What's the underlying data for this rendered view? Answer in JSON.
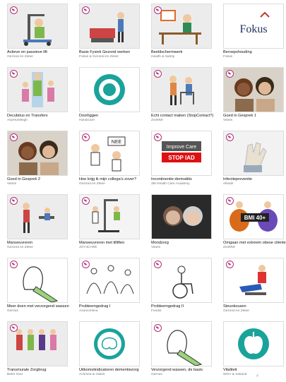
{
  "tiles": [
    {
      "title": "Actieve en passieve lift",
      "subtitle": "Gezond en Zeker",
      "badge": true,
      "art": "lift"
    },
    {
      "title": "Basis Fysiek Gezond werken",
      "subtitle": "Fokus & Gezond en Zeker",
      "badge": true,
      "art": "worker"
    },
    {
      "title": "Beeldschermwerk",
      "subtitle": "Health & Safety",
      "badge": true,
      "art": "desk"
    },
    {
      "title": "Beroepshouding",
      "subtitle": "Fokus",
      "badge": false,
      "art": "fokus"
    },
    {
      "title": "Decubitus en Transfers",
      "subtitle": "ArjoHuntleigh",
      "badge": true,
      "art": "bed"
    },
    {
      "title": "Doorliggen",
      "subtitle": "Handicare",
      "badge": false,
      "art": "target"
    },
    {
      "title": "Écht contact maken (StopContact?)",
      "subtitle": "ZonMW",
      "badge": true,
      "art": "walker"
    },
    {
      "title": "Goed in Gesprek 1",
      "subtitle": "Vilans",
      "badge": true,
      "art": "photo"
    },
    {
      "title": "Goed in Gesprek 2",
      "subtitle": "Vilans",
      "badge": true,
      "art": "photo"
    },
    {
      "title": "Hoe krijg ik mijn collega's zover?",
      "subtitle": "Gezond en Zeker",
      "badge": true,
      "art": "nee"
    },
    {
      "title": "Incontinentie-dermatitis",
      "subtitle": "3M Health Care Academy",
      "badge": true,
      "art": "stopiad"
    },
    {
      "title": "Infectiepreventie",
      "subtitle": "Alliade",
      "badge": true,
      "art": "gloves"
    },
    {
      "title": "Manoeuvreren",
      "subtitle": "Gezond en Zeker",
      "badge": true,
      "art": "manoeuvre"
    },
    {
      "title": "Manoeuvreren met tilliften",
      "subtitle": "JOY4CARE",
      "badge": true,
      "art": "hoist"
    },
    {
      "title": "Mondzorg",
      "subtitle": "Vilans",
      "badge": false,
      "art": "photo2"
    },
    {
      "title": "Omgaan met extreem obese cliënten",
      "subtitle": "ZonMW",
      "badge": true,
      "art": "bmi"
    },
    {
      "title": "Meer doen met verzorgend wassen",
      "subtitle": "Gerrius",
      "badge": true,
      "art": "mitt"
    },
    {
      "title": "Probleemgedrag I",
      "subtitle": "Axoncontinu",
      "badge": true,
      "art": "sketch"
    },
    {
      "title": "Probleemgedrag II",
      "subtitle": "Fundis",
      "badge": true,
      "art": "wheelchair"
    },
    {
      "title": "Steunkousen",
      "subtitle": "Gezond en Zeker",
      "badge": true,
      "art": "stocking"
    },
    {
      "title": "Transmurale Zorgbrug",
      "subtitle": "Beter Oud",
      "badge": true,
      "art": "people"
    },
    {
      "title": "Uitkomstindicatoren dementiezorg",
      "subtitle": "Achmea & Vilans",
      "badge": false,
      "art": "brain"
    },
    {
      "title": "Verzorgend wassen, de basis",
      "subtitle": "Gerrius",
      "badge": true,
      "art": "mitt"
    },
    {
      "title": "Vitaliteit",
      "subtitle": "WGV & Solland",
      "badge": false,
      "art": "apple"
    }
  ],
  "art_text": {
    "fokus": "Fokus",
    "nee": "NEE",
    "improve": "Improve Care",
    "stopiad": "STOP IAD",
    "bmi": "BMI 40+"
  },
  "footer": "∠"
}
